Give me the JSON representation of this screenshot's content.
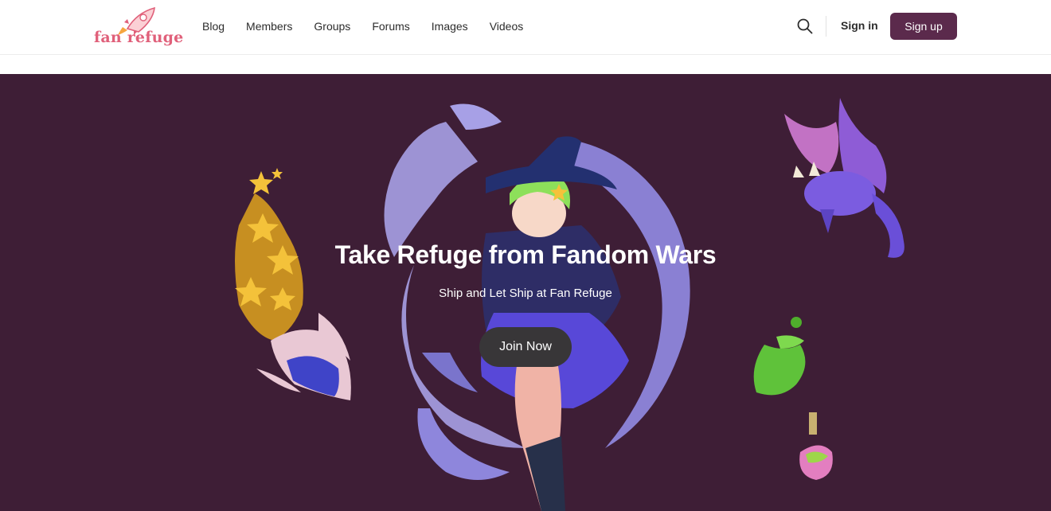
{
  "brand": {
    "name": "fan refuge",
    "logo_color": "#e0607a"
  },
  "nav": {
    "items": [
      {
        "label": "Blog"
      },
      {
        "label": "Members"
      },
      {
        "label": "Groups"
      },
      {
        "label": "Forums"
      },
      {
        "label": "Images"
      },
      {
        "label": "Videos"
      }
    ]
  },
  "header": {
    "search_icon": "search-icon",
    "signin_label": "Sign in",
    "signup_label": "Sign up"
  },
  "hero": {
    "title": "Take Refuge from Fandom Wars",
    "subtitle": "Ship and Let Ship at Fan Refuge",
    "cta_label": "Join Now",
    "background_color": "#3e1e36"
  },
  "colors": {
    "accent": "#5b2a4c",
    "cta_bg": "#383638"
  }
}
